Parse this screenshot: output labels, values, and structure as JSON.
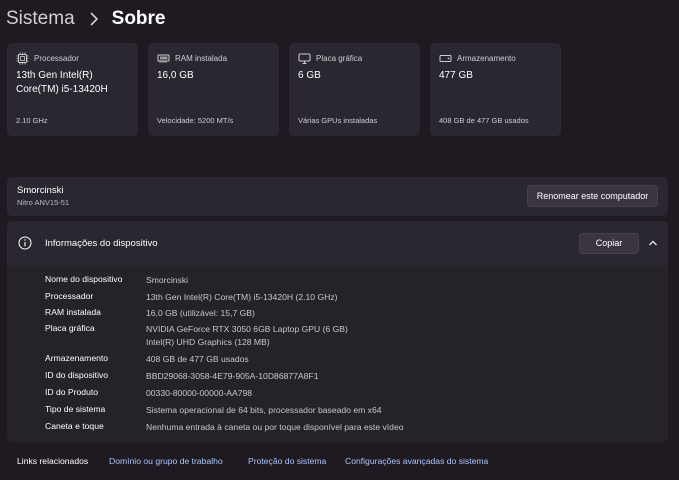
{
  "breadcrumb": {
    "parent": "Sistema",
    "current": "Sobre"
  },
  "cards": [
    {
      "icon": "processor-icon",
      "label": "Processador",
      "value_line1": "13th Gen Intel(R)",
      "value_line2": "Core(TM) i5-13420H",
      "sub": "2.10 GHz"
    },
    {
      "icon": "ram-icon",
      "label": "RAM instalada",
      "value_line1": "16,0 GB",
      "value_line2": "",
      "sub": "Velocidade: 5200 MT/s"
    },
    {
      "icon": "gpu-icon",
      "label": "Placa gráfica",
      "value_line1": "6 GB",
      "value_line2": "",
      "sub": "Várias GPUs instaladas"
    },
    {
      "icon": "storage-icon",
      "label": "Armazenamento",
      "value_line1": "477 GB",
      "value_line2": "",
      "sub": "408 GB de 477 GB usados"
    }
  ],
  "computer": {
    "name": "Smorcinski",
    "model": "Nitro ANV15-51",
    "rename_label": "Renomear este computador"
  },
  "device_info": {
    "title": "Informações do dispositivo",
    "copy_label": "Copiar",
    "rows": [
      {
        "label": "Nome do dispositivo",
        "value": "Smorcinski"
      },
      {
        "label": "Processador",
        "value": "13th Gen Intel(R) Core(TM) i5-13420H (2.10 GHz)"
      },
      {
        "label": "RAM instalada",
        "value": "16,0 GB (utilizável: 15,7 GB)"
      },
      {
        "label": "Placa gráfica",
        "value": "NVIDIA GeForce RTX 3050 6GB Laptop GPU (6 GB)",
        "value2": "Intel(R) UHD Graphics (128 MB)"
      },
      {
        "label": "Armazenamento",
        "value": "408 GB de 477 GB usados"
      },
      {
        "label": "ID do dispositivo",
        "value": "BBD29068-3058-4E79-905A-10D86877A8F1"
      },
      {
        "label": "ID do Produto",
        "value": "00330-80000-00000-AA798"
      },
      {
        "label": "Tipo de sistema",
        "value": "Sistema operacional de 64 bits, processador baseado em x64"
      },
      {
        "label": "Caneta e toque",
        "value": "Nenhuma entrada à caneta ou por toque disponível para este vídeo"
      }
    ]
  },
  "related": {
    "label": "Links relacionados",
    "links": [
      "Domínio ou grupo de trabalho",
      "Proteção do sistema",
      "Configurações avançadas do sistema"
    ]
  }
}
